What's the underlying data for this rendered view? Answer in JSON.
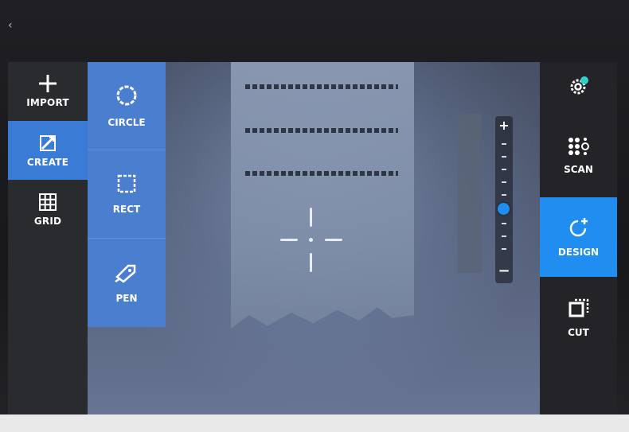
{
  "left_nav": {
    "items": [
      {
        "label": "IMPORT",
        "icon": "plus-icon",
        "active": false
      },
      {
        "label": "CREATE",
        "icon": "shape-edit-icon",
        "active": true
      },
      {
        "label": "GRID",
        "icon": "grid-icon",
        "active": false
      }
    ]
  },
  "create_tools": {
    "items": [
      {
        "label": "CIRCLE",
        "icon": "circle-icon"
      },
      {
        "label": "RECT",
        "icon": "rectangle-icon"
      },
      {
        "label": "PEN",
        "icon": "pen-icon"
      }
    ]
  },
  "right_nav": {
    "settings_icon": "gear-icon",
    "items": [
      {
        "label": "SCAN",
        "icon": "scan-icon",
        "active": false
      },
      {
        "label": "DESIGN",
        "icon": "design-icon",
        "active": true
      },
      {
        "label": "CUT",
        "icon": "cut-icon",
        "active": false
      }
    ]
  },
  "zoom": {
    "plus_label": "+",
    "minus_label": "−",
    "level": 0.6
  },
  "colors": {
    "accent": "#1f8ef0",
    "create_panel": "#4a7fd0",
    "rail": "#2a2b2f"
  }
}
